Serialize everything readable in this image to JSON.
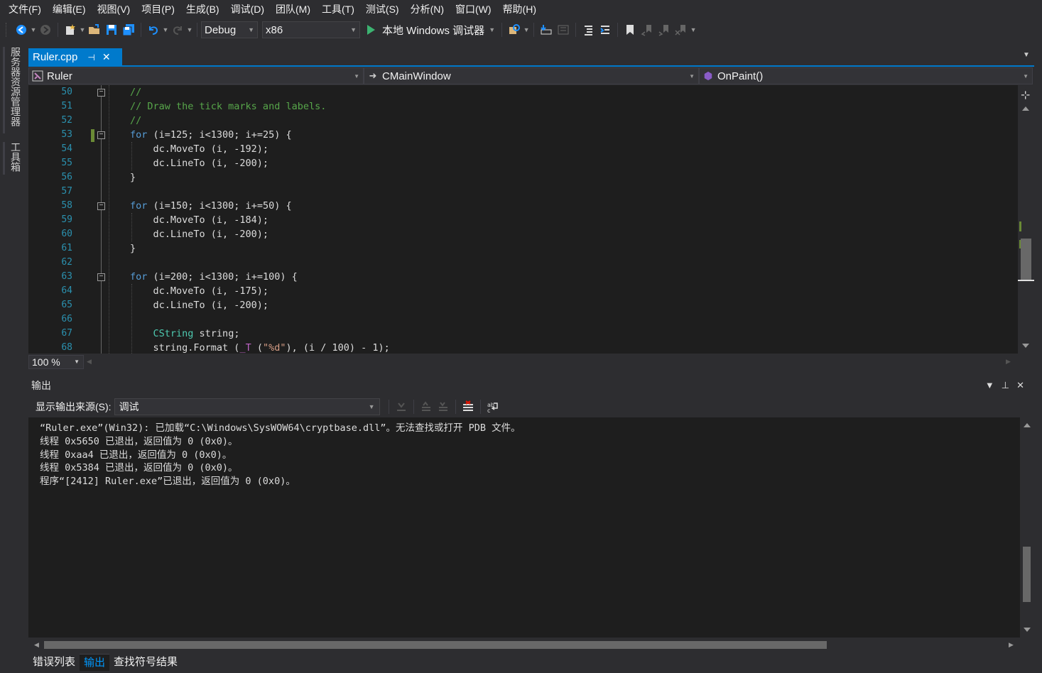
{
  "menu": [
    "文件(F)",
    "编辑(E)",
    "视图(V)",
    "项目(P)",
    "生成(B)",
    "调试(D)",
    "团队(M)",
    "工具(T)",
    "测试(S)",
    "分析(N)",
    "窗口(W)",
    "帮助(H)"
  ],
  "toolbar": {
    "config": "Debug",
    "platform": "x86",
    "run_label": "本地 Windows 调试器"
  },
  "side_tabs": [
    "服务器资源管理器",
    "工具箱"
  ],
  "document_tab": {
    "title": "Ruler.cpp",
    "pin": "⊣",
    "close": "✕"
  },
  "navbar": {
    "project": "Ruler",
    "class": "CMainWindow",
    "member": "OnPaint()"
  },
  "code": {
    "line_numbers": [
      "50",
      "51",
      "52",
      "53",
      "54",
      "55",
      "56",
      "57",
      "58",
      "59",
      "60",
      "61",
      "62",
      "63",
      "64",
      "65",
      "66",
      "67",
      "68"
    ]
  },
  "zoom": "100 %",
  "output": {
    "title": "输出",
    "source_label": "显示输出来源(S):",
    "source_value": "调试",
    "lines": [
      "“Ruler.exe”(Win32): 已加载“C:\\Windows\\SysWOW64\\cryptbase.dll”。无法查找或打开 PDB 文件。",
      "线程 0x5650 已退出，返回值为 0 (0x0)。",
      "线程 0xaa4 已退出，返回值为 0 (0x0)。",
      "线程 0x5384 已退出，返回值为 0 (0x0)。",
      "程序“[2412] Ruler.exe”已退出，返回值为 0 (0x0)。"
    ]
  },
  "bottom_tabs": [
    "错误列表",
    "输出",
    "查找符号结果"
  ],
  "colors": {
    "accent": "#007acc",
    "line_number": "#2b91af",
    "comment": "#57a64a",
    "keyword": "#569cd6",
    "type": "#4ec9b0",
    "string": "#d69d85"
  }
}
